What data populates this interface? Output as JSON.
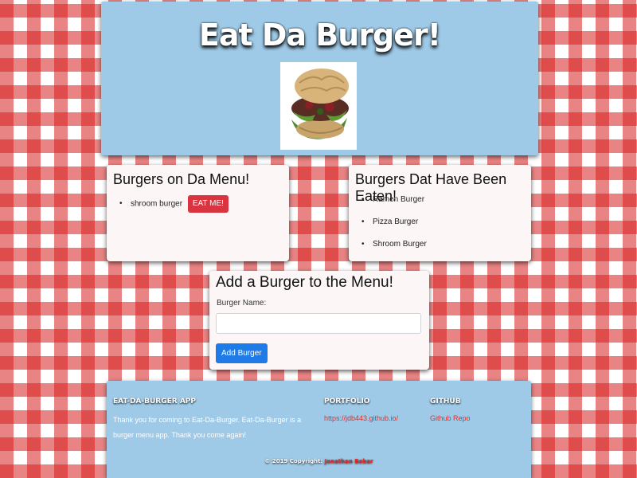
{
  "header": {
    "title": "Eat Da Burger!",
    "image_icon": "burger-photo"
  },
  "menu": {
    "title": "Burgers on Da Menu!",
    "items": [
      {
        "name": "shroom burger",
        "button_label": "EAT ME!"
      }
    ]
  },
  "eaten": {
    "title": "Burgers Dat Have Been Eaten!",
    "items": [
      "Ramen Burger",
      "Pizza Burger",
      "Shroom Burger"
    ]
  },
  "add_form": {
    "title": "Add a Burger to the Menu!",
    "label": "Burger Name:",
    "input_value": "",
    "button_label": "Add Burger"
  },
  "footer": {
    "about_heading": "EAT-DA-BURGER APP",
    "about_text": "Thank you for coming to Eat-Da-Burger. Eat-Da-Burger is a burger menu app. Thank you come again!",
    "portfolio_heading": "PORTFOLIO",
    "portfolio_link": "https://jdb443.github.io/",
    "github_heading": "GITHUB",
    "github_link": "Github Repo",
    "copyright_prefix": "© 2019 Copyright:",
    "copyright_author": "Jonathan Bebar"
  },
  "colors": {
    "header_bg": "#9ecae8",
    "tablecloth_red": "#d61e1e",
    "eat_button": "#d9343f",
    "add_button": "#1e7be8",
    "link": "#e0302c"
  }
}
